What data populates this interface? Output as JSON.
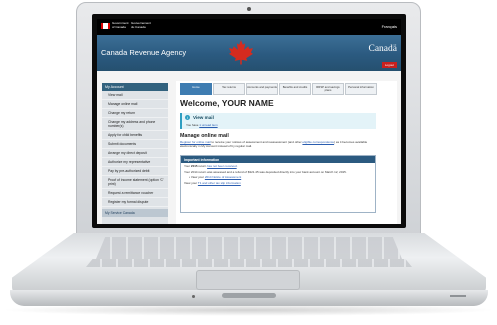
{
  "gov": {
    "en_line1": "Government",
    "en_line2": "of Canada",
    "fr_line1": "Gouvernement",
    "fr_line2": "du Canada",
    "language_toggle": "Français"
  },
  "banner": {
    "agency": "Canada Revenue Agency",
    "wordmark": "Canadä",
    "logout": "Logout",
    "colors": {
      "banner": "#2b5a80",
      "leaf": "#d52b1e",
      "logout": "#c8201e"
    }
  },
  "sidebar": {
    "heading": "My Account",
    "items": [
      "View mail",
      "Manage online mail",
      "Change my return",
      "Change my address and phone number(s)",
      "Apply for child benefits",
      "Submit documents",
      "Arrange my direct deposit",
      "Authorize my representative",
      "Pay by pre-authorized debit",
      "Proof of income statement (option 'C' print)",
      "Request a remittance voucher",
      "Register my formal dispute"
    ],
    "footer": "My Service Canada"
  },
  "tabs": [
    "Home",
    "Tax returns",
    "Accounts and payments",
    "Benefits and credits",
    "RRSP and savings plans",
    "Personal information"
  ],
  "main": {
    "welcome": "Welcome, YOUR NAME",
    "alert": {
      "icon": "info-icon",
      "title": "View mail",
      "text_prefix": "You have ",
      "link": "1 unread item"
    },
    "manage_title": "Manage online mail",
    "manage_link": "Register for online mail",
    "manage_text_1": " to receive your notices of assessment and reassessment (and other ",
    "manage_link_2": "eligible correspondence",
    "manage_text_2": ") as it becomes available electronically in My Account instead of by regular mail.",
    "panel": {
      "title": "Important information",
      "line1_prefix": "Your ",
      "line1_year": "2015",
      "line1_mid": " return ",
      "line1_link": "has not been received",
      "line1_suffix": ".",
      "line2": "Your 2014 return was assessed and a refund of $321.45 was deposited directly into your bank account on March 12, 2015.",
      "line2_sub_prefix": "View your ",
      "line2_sub_link": "2014 Notice of Assessment",
      "line3_prefix": "View your ",
      "line3_link": "T1 and other tax slip information"
    }
  }
}
